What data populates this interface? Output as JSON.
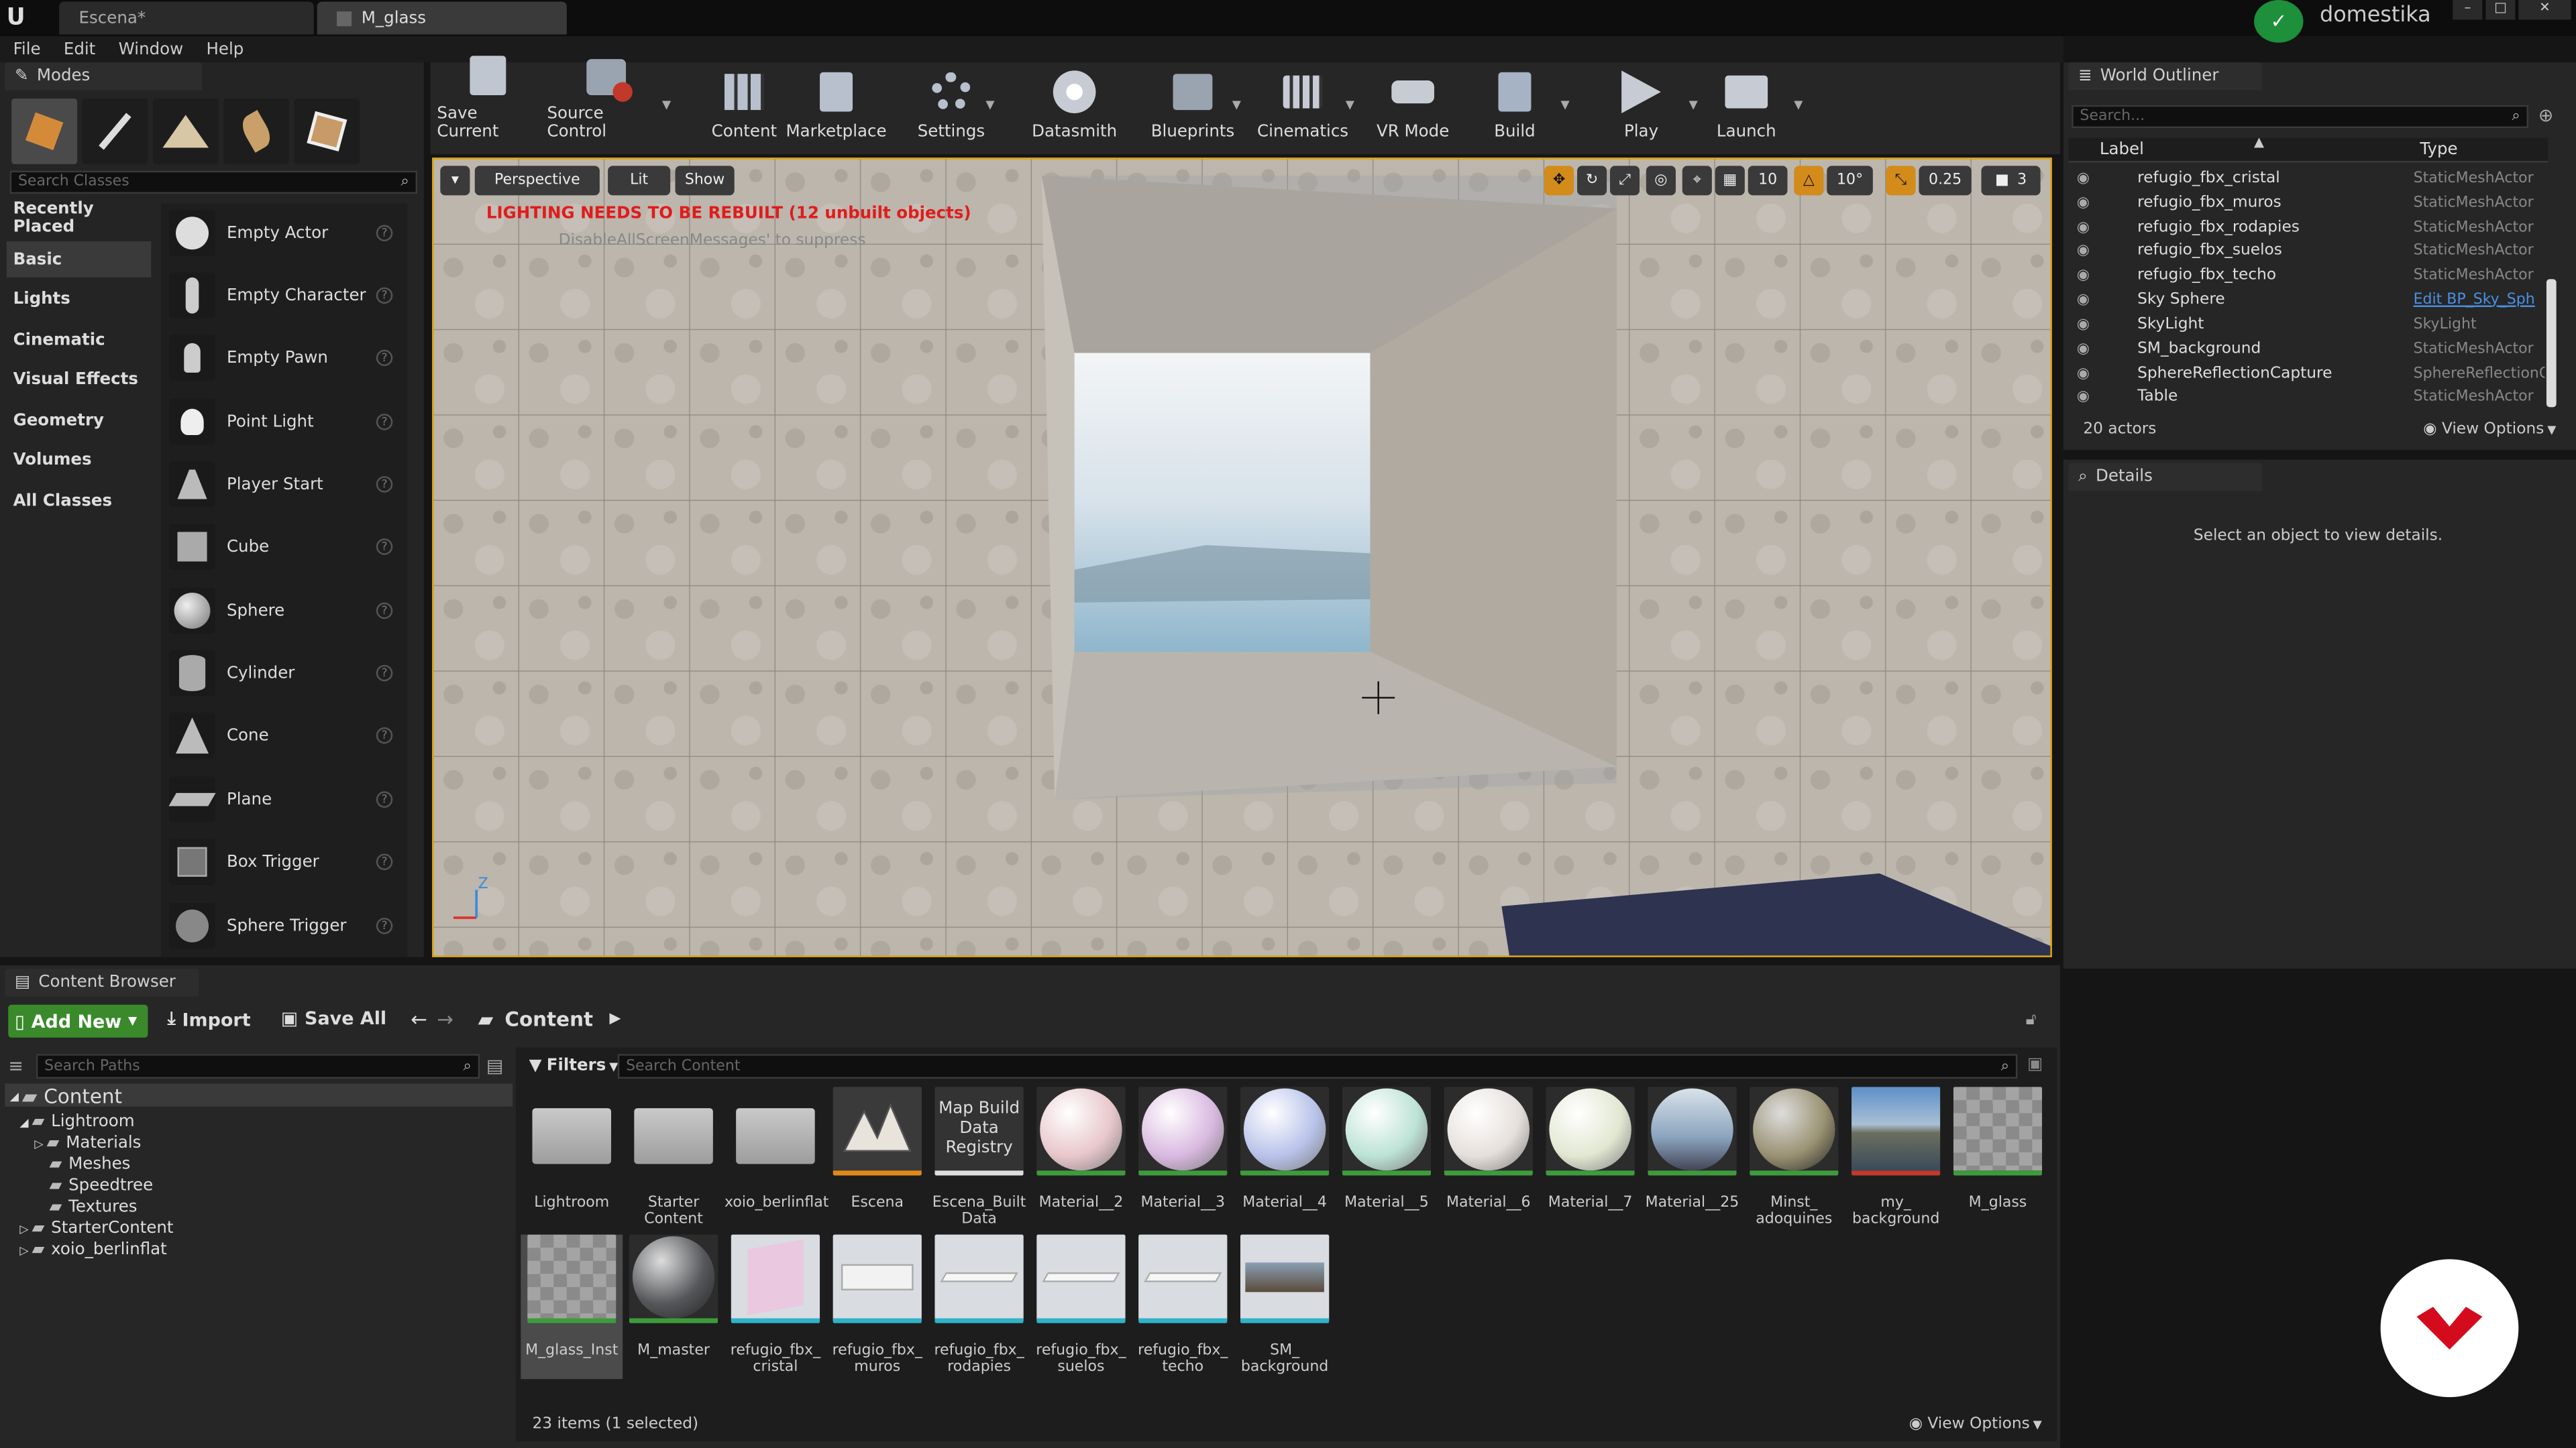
{
  "window": {
    "tabs": [
      {
        "label": "Escena*"
      },
      {
        "label": "M_glass"
      }
    ],
    "user": "domestika",
    "controls": {
      "minimize": "–",
      "maximize": "□",
      "close": "✕"
    }
  },
  "menu": [
    "File",
    "Edit",
    "Window",
    "Help"
  ],
  "modes": {
    "title": "Modes",
    "search_placeholder": "Search Classes",
    "categories": [
      "Recently Placed",
      "Basic",
      "Lights",
      "Cinematic",
      "Visual Effects",
      "Geometry",
      "Volumes",
      "All Classes"
    ],
    "selected_category": "Basic",
    "items": [
      "Empty Actor",
      "Empty Character",
      "Empty Pawn",
      "Point Light",
      "Player Start",
      "Cube",
      "Sphere",
      "Cylinder",
      "Cone",
      "Plane",
      "Box Trigger",
      "Sphere Trigger"
    ],
    "help_glyph": "?"
  },
  "toolbar": [
    {
      "label": "Save Current",
      "icon": "save-icon"
    },
    {
      "label": "Source Control",
      "icon": "source-control-icon"
    },
    {
      "label": "Content",
      "icon": "content-icon"
    },
    {
      "label": "Marketplace",
      "icon": "marketplace-icon"
    },
    {
      "label": "Settings",
      "icon": "settings-icon"
    },
    {
      "label": "Datasmith",
      "icon": "datasmith-icon"
    },
    {
      "label": "Blueprints",
      "icon": "blueprints-icon"
    },
    {
      "label": "Cinematics",
      "icon": "cinematics-icon"
    },
    {
      "label": "VR Mode",
      "icon": "vr-icon"
    },
    {
      "label": "Build",
      "icon": "build-icon"
    },
    {
      "label": "Play",
      "icon": "play-icon"
    },
    {
      "label": "Launch",
      "icon": "launch-icon"
    }
  ],
  "viewport": {
    "perspective": "Perspective",
    "lit": "Lit",
    "show": "Show",
    "warning": "LIGHTING NEEDS TO BE REBUILT (12 unbuilt objects)",
    "warning_sub": "DisableAllScreenMessages' to suppress",
    "grid_snap": "10",
    "rot_snap": "10°",
    "scale_snap": "0.25",
    "cam_speed": "3",
    "axis_z": "Z"
  },
  "outliner": {
    "title": "World Outliner",
    "search_placeholder": "Search...",
    "col_label": "Label",
    "col_type": "Type",
    "rows": [
      {
        "label": "refugio_fbx_cristal",
        "type": "StaticMeshActor"
      },
      {
        "label": "refugio_fbx_muros",
        "type": "StaticMeshActor"
      },
      {
        "label": "refugio_fbx_rodapies",
        "type": "StaticMeshActor"
      },
      {
        "label": "refugio_fbx_suelos",
        "type": "StaticMeshActor"
      },
      {
        "label": "refugio_fbx_techo",
        "type": "StaticMeshActor"
      },
      {
        "label": "Sky Sphere",
        "type": "Edit BP_Sky_Sph"
      },
      {
        "label": "SkyLight",
        "type": "SkyLight"
      },
      {
        "label": "SM_background",
        "type": "StaticMeshActor"
      },
      {
        "label": "SphereReflectionCapture",
        "type": "SphereReflectionC"
      },
      {
        "label": "Table",
        "type": "StaticMeshActor"
      }
    ],
    "count": "20 actors",
    "view_options": "View Options"
  },
  "details": {
    "title": "Details",
    "empty": "Select an object to view details."
  },
  "content_browser": {
    "title": "Content Browser",
    "add_new": "Add New",
    "import": "Import",
    "save_all": "Save All",
    "path": "Content",
    "search_paths_placeholder": "Search Paths",
    "filters": "Filters",
    "search_content_placeholder": "Search Content",
    "tree": [
      {
        "label": "Content",
        "level": 0
      },
      {
        "label": "Lightroom",
        "level": 1
      },
      {
        "label": "Materials",
        "level": 2
      },
      {
        "label": "Meshes",
        "level": 2
      },
      {
        "label": "Speedtree",
        "level": 2
      },
      {
        "label": "Textures",
        "level": 2
      },
      {
        "label": "StarterContent",
        "level": 1
      },
      {
        "label": "xoio_berlinflat",
        "level": 1
      }
    ],
    "assets_row1": [
      {
        "label": "Lightroom",
        "kind": "folder"
      },
      {
        "label": "Starter Content",
        "kind": "folder"
      },
      {
        "label": "xoio_berlinflat",
        "kind": "folder"
      },
      {
        "label": "Escena",
        "kind": "level"
      },
      {
        "label": "Escena_Built Data",
        "kind": "mapdata",
        "text": "Map Build Data Registry"
      },
      {
        "label": "Material__2",
        "kind": "sphere",
        "color": "#e8c7cc"
      },
      {
        "label": "Material__3",
        "kind": "sphere",
        "color": "#d9b9e0"
      },
      {
        "label": "Material__4",
        "kind": "sphere",
        "color": "#b9c3ea"
      },
      {
        "label": "Material__5",
        "kind": "sphere",
        "color": "#bde3d6"
      },
      {
        "label": "Material__6",
        "kind": "sphere",
        "color": "#e6e0dc"
      },
      {
        "label": "Material__7",
        "kind": "sphere",
        "color": "#e2e7d2"
      },
      {
        "label": "Material__25",
        "kind": "sky",
        "color": "#8aa3bd"
      },
      {
        "label": "Minst_ adoquines",
        "kind": "stone",
        "color": "#9a9273"
      },
      {
        "label": "my_ background",
        "kind": "photo",
        "color": "#5f7fa3"
      },
      {
        "label": "M_glass",
        "kind": "checker"
      }
    ],
    "assets_row2": [
      {
        "label": "M_glass_Inst",
        "kind": "checker"
      },
      {
        "label": "M_master",
        "kind": "stone",
        "color": "#55575a"
      },
      {
        "label": "refugio_fbx_ cristal",
        "kind": "mesh-pink"
      },
      {
        "label": "refugio_fbx_ muros",
        "kind": "mesh"
      },
      {
        "label": "refugio_fbx_ rodapies",
        "kind": "mesh-flat"
      },
      {
        "label": "refugio_fbx_ suelos",
        "kind": "mesh-flat"
      },
      {
        "label": "refugio_fbx_ techo",
        "kind": "mesh-flat"
      },
      {
        "label": "SM_ background",
        "kind": "mesh-photo"
      }
    ],
    "status": "23 items (1 selected)",
    "view_options": "View Options"
  }
}
